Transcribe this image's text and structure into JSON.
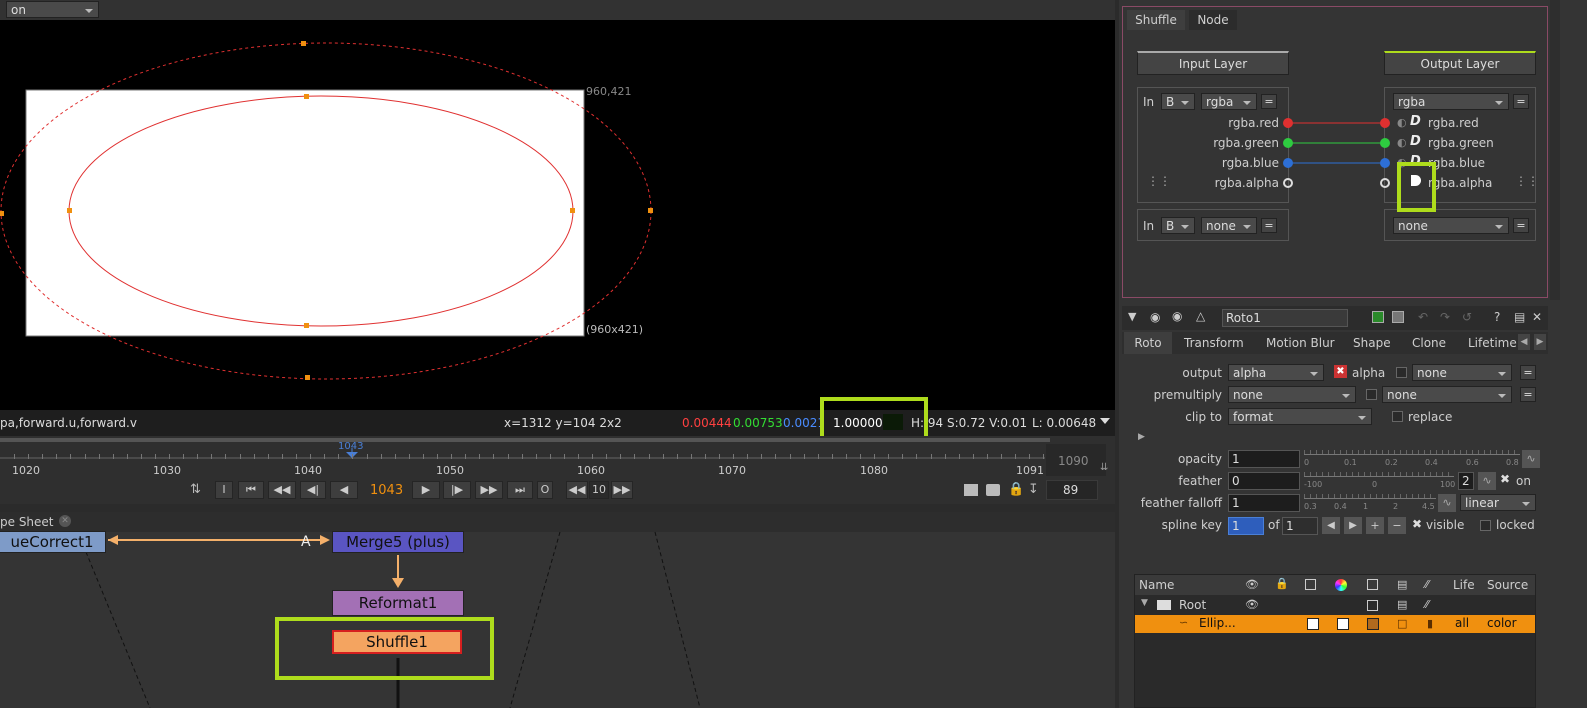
{
  "viewer": {
    "selection_mode": "on selection",
    "format_corner_label": "960,421",
    "format_size_label": "(960x421)"
  },
  "info_bar": {
    "channels_text": "pa,forward.u,forward.v",
    "coords_text": "x=1312 y=104 2x2",
    "red_value": "0.00444",
    "green_value": "0.00753",
    "blue_value": "0.0021",
    "alpha_value": "1.00000",
    "hsv_text": "H: 94 S:0.72 V:0.01",
    "lum_text": "L: 0.00648",
    "colors": {
      "red": "#ff4040",
      "green": "#33dd33",
      "blue": "#4a8cff"
    }
  },
  "timeline": {
    "ticks": [
      "1020",
      "1030",
      "1040",
      "1050",
      "1060",
      "1070",
      "1080",
      "1091"
    ],
    "playhead_frame": "1043",
    "end_frame": "1090",
    "current_frame": "1043",
    "increment": "10",
    "fps_field": "89",
    "in_label": "I",
    "out_label": "O"
  },
  "dag": {
    "tab_label": "pe Sheet",
    "nodes": {
      "huecorrect": "ueCorrect1",
      "merge": "Merge5 (plus)",
      "merge_input": "A",
      "reformat": "Reformat1",
      "shuffle": "Shuffle1"
    }
  },
  "shuffle_panel": {
    "tabs": [
      "Shuffle",
      "Node"
    ],
    "input_layer_label": "Input Layer",
    "output_layer_label": "Output Layer",
    "in_label": "In",
    "in1_source": "B",
    "in1_layer": "rgba",
    "in2_source": "B",
    "in2_layer": "none",
    "out1_layer": "rgba",
    "out2_layer": "none",
    "eq_label": "=",
    "channels_in": [
      "rgba.red",
      "rgba.green",
      "rgba.blue",
      "rgba.alpha"
    ],
    "channels_out": [
      "rgba.red",
      "rgba.green",
      "rgba.blue",
      "rgba.alpha"
    ],
    "channel_colors": [
      "#e03030",
      "#2ecc40",
      "#2d6fd6",
      "#ffffff"
    ]
  },
  "roto_panel": {
    "node_name": "Roto1",
    "tabs": [
      "Roto",
      "Transform",
      "Motion Blur",
      "Shape",
      "Clone",
      "Lifetime"
    ],
    "output_label": "output",
    "output_value": "alpha",
    "alpha_label": "alpha",
    "output_right_value": "none",
    "premultiply_label": "premultiply",
    "premultiply_value": "none",
    "premultiply_right_value": "none",
    "clip_to_label": "clip to",
    "clip_to_value": "format",
    "replace_label": "replace",
    "opacity_label": "opacity",
    "opacity_value": "1",
    "opacity_ticks": [
      "0",
      "0.1",
      "0.2",
      "0.4",
      "0.6",
      "0.8"
    ],
    "feather_label": "feather",
    "feather_value": "0",
    "feather_ticks": [
      "-100",
      "0",
      "100"
    ],
    "feather_multiplier": "2",
    "feather_on_label": "on",
    "feather_falloff_label": "feather falloff",
    "feather_falloff_value": "1",
    "feather_falloff_ticks": [
      "0.3",
      "0.4",
      "1",
      "2",
      "4.5"
    ],
    "falloff_type": "linear",
    "spline_key_label": "spline key",
    "spline_key_value": "1",
    "spline_of_label": "of",
    "spline_total": "1",
    "visible_label": "visible",
    "locked_label": "locked",
    "list_headers": {
      "name": "Name",
      "life": "Life",
      "source": "Source"
    },
    "root_label": "Root",
    "ellipse_item": "Ellip...",
    "ellipse_life": "all",
    "ellipse_source": "color",
    "accent_color": "#f0900f"
  }
}
